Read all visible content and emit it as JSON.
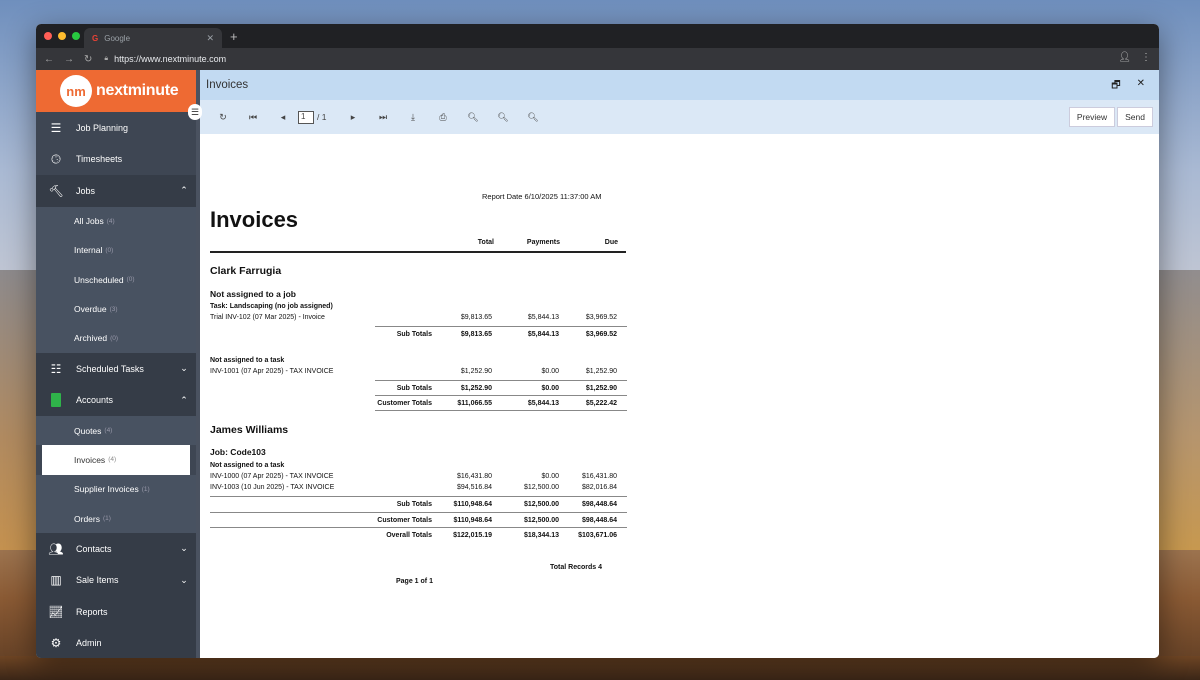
{
  "browser": {
    "tab_title": "Google",
    "tab_icon": "G",
    "url": "https://www.nextminute.com"
  },
  "brand": {
    "logo_text": "nm",
    "name": "nextminute"
  },
  "sidebar": {
    "items": [
      {
        "label": "Job Planning",
        "icon": "hamburger-icon"
      },
      {
        "label": "Timesheets",
        "icon": "clock-icon"
      },
      {
        "label": "Jobs",
        "icon": "hammer-icon",
        "chevron": "up"
      },
      {
        "label": "Scheduled Tasks",
        "icon": "checklist-icon",
        "chevron": "down"
      },
      {
        "label": "Accounts",
        "icon": "document-icon",
        "chevron": "up"
      },
      {
        "label": "Contacts",
        "icon": "people-icon",
        "chevron": "down"
      },
      {
        "label": "Sale Items",
        "icon": "barcode-icon",
        "chevron": "down"
      },
      {
        "label": "Reports",
        "icon": "chart-icon"
      },
      {
        "label": "Admin",
        "icon": "gear-icon"
      }
    ],
    "jobs_sub": [
      {
        "label": "All Jobs",
        "count": "(4)"
      },
      {
        "label": "Internal",
        "count": "(0)"
      },
      {
        "label": "Unscheduled",
        "count": "(0)"
      },
      {
        "label": "Overdue",
        "count": "(3)"
      },
      {
        "label": "Archived",
        "count": "(0)"
      }
    ],
    "accounts_sub": [
      {
        "label": "Quotes",
        "count": "(4)"
      },
      {
        "label": "Invoices",
        "count": "(4)"
      },
      {
        "label": "Supplier Invoices",
        "count": "(1)"
      },
      {
        "label": "Orders",
        "count": "(1)"
      }
    ]
  },
  "panel": {
    "title": "Invoices"
  },
  "toolbar": {
    "page_current": "1",
    "page_total": "/ 1",
    "preview_label": "Preview",
    "send_label": "Send"
  },
  "report": {
    "report_date": "Report Date 6/10/2025 11:37:00 AM",
    "title": "Invoices",
    "headers": {
      "total": "Total",
      "payments": "Payments",
      "due": "Due"
    },
    "customer1": {
      "name": "Clark Farrugia",
      "group1": "Not assigned to a job",
      "task1": "Task: Landscaping (no job assigned)",
      "row1": {
        "desc": "Trial INV-102 (07 Mar 2025) - Invoice",
        "total": "$9,813.65",
        "payments": "$5,844.13",
        "due": "$3,969.52"
      },
      "sub1": {
        "label": "Sub Totals",
        "total": "$9,813.65",
        "payments": "$5,844.13",
        "due": "$3,969.52"
      },
      "task2": "Not assigned to a task",
      "row2": {
        "desc": "INV-1001 (07 Apr 2025) - TAX INVOICE",
        "total": "$1,252.90",
        "payments": "$0.00",
        "due": "$1,252.90"
      },
      "sub2": {
        "label": "Sub Totals",
        "total": "$1,252.90",
        "payments": "$0.00",
        "due": "$1,252.90"
      },
      "cust_total": {
        "label": "Customer Totals",
        "total": "$11,066.55",
        "payments": "$5,844.13",
        "due": "$5,222.42"
      }
    },
    "customer2": {
      "name": "James Williams",
      "group1": "Job: Code103",
      "task1": "Not assigned to a task",
      "row1": {
        "desc": "INV-1000 (07 Apr 2025) - TAX INVOICE",
        "total": "$16,431.80",
        "payments": "$0.00",
        "due": "$16,431.80"
      },
      "row2": {
        "desc": "INV-1003 (10 Jun 2025) - TAX INVOICE",
        "total": "$94,516.84",
        "payments": "$12,500.00",
        "due": "$82,016.84"
      },
      "sub1": {
        "label": "Sub Totals",
        "total": "$110,948.64",
        "payments": "$12,500.00",
        "due": "$98,448.64"
      },
      "cust_total": {
        "label": "Customer Totals",
        "total": "$110,948.64",
        "payments": "$12,500.00",
        "due": "$98,448.64"
      }
    },
    "overall": {
      "label": "Overall Totals",
      "total": "$122,015.19",
      "payments": "$18,344.13",
      "due": "$103,671.06"
    },
    "total_records": "Total Records 4",
    "page_footer": "Page 1 of 1"
  }
}
